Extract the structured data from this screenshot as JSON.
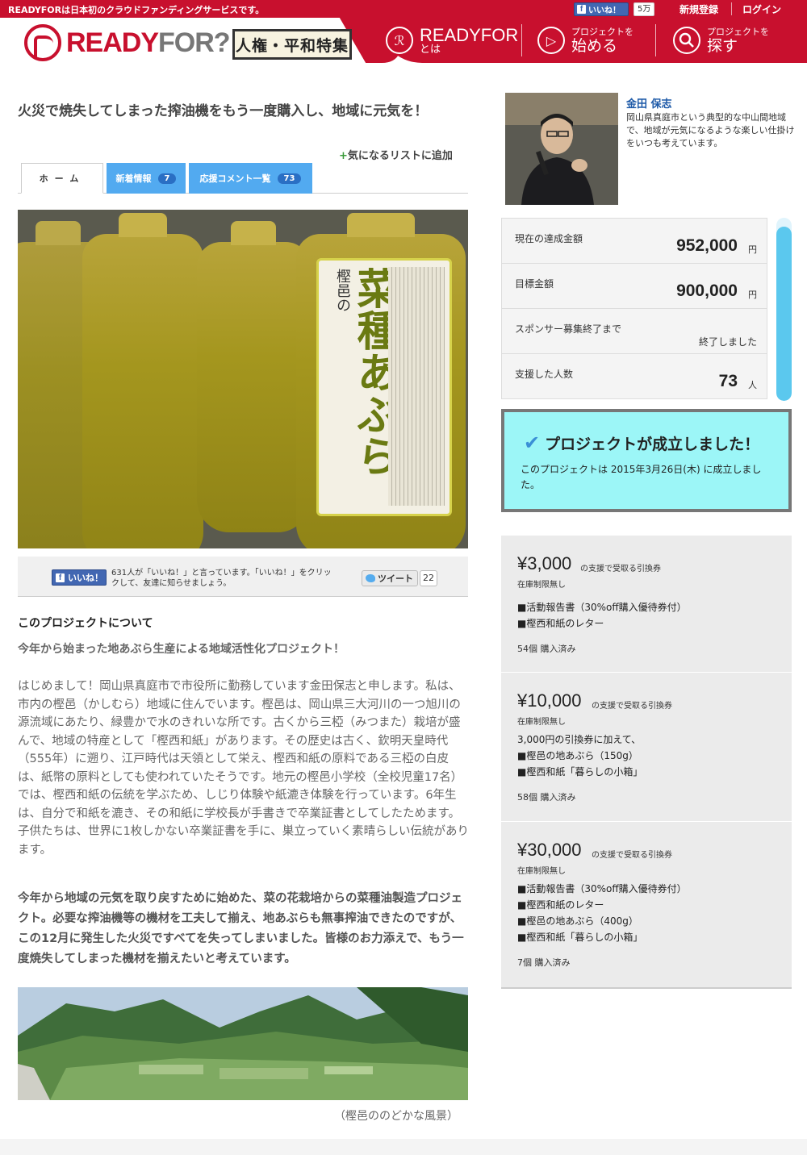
{
  "header": {
    "tagline": "READYFORは日本初のクラウドファンディングサービスです。",
    "fb_like_label": "いいね！",
    "fb_like_count": "5万",
    "signup_label": "新規登録",
    "login_label": "ログイン",
    "logo_ready": "READY",
    "logo_for": "FOR?",
    "campaign_badge": "人権・平和特集",
    "nav_about_big": "READYFOR",
    "nav_about_small": "とは",
    "nav_start_small": "プロジェクトを",
    "nav_start_big": "始める",
    "nav_search_small": "プロジェクトを",
    "nav_search_big": "探す"
  },
  "project": {
    "title": "火災で焼失してしまった搾油機をもう一度購入し、地域に元気を！",
    "watch_label": "気になるリストに追加",
    "tabs": [
      {
        "label": "ホーム"
      },
      {
        "label": "新着情報",
        "count": "7"
      },
      {
        "label": "応援コメント一覧",
        "count": "73"
      }
    ],
    "bottle_label_small": "樫邑の",
    "bottle_label_big": "菜種あぶら",
    "share": {
      "fb_like_label": "いいね！",
      "fb_like_text": "631人が「いいね！」と言っています。「いいね！」をクリックして、友達に知らせましょう。",
      "tweet_label": "ツイート",
      "tweet_count": "22"
    },
    "about_heading": "このプロジェクトについて",
    "about_subheading": "今年から始まった地あぶら生産による地域活性化プロジェクト！",
    "paragraph_1": "はじめまして！岡山県真庭市で市役所に勤務しています金田保志と申します。私は、市内の樫邑（かしむら）地域に住んでいます。樫邑は、岡山県三大河川の一つ旭川の源流域にあたり、緑豊かで水のきれいな所です。古くから三椏（みつまた）栽培が盛んで、地域の特産として「樫西和紙」があります。その歴史は古く、欽明天皇時代（555年）に遡り、江戸時代は天領として栄え、樫西和紙の原料である三椏の白皮は、紙幣の原料としても使われていたそうです。地元の樫邑小学校（全校児童17名）では、樫西和紙の伝統を学ぶため、しじり体験や紙漉き体験を行っています。6年生は、自分で和紙を漉き、その和紙に学校長が手書きで卒業証書としてしたためます。子供たちは、世界に1枚しかない卒業証書を手に、巣立っていく素晴らしい伝統があります。",
    "paragraph_2": "今年から地域の元気を取り戻すために始めた、菜の花栽培からの菜種油製造プロジェクト。必要な搾油機等の機材を工夫して揃え、地あぶらも無事搾油できたのですが、この12月に発生した火災ですべてを失ってしまいました。皆様のお力添えで、もう一度焼失してしまった機材を揃えたいと考えています。",
    "caption": "（樫邑ののどかな風景）"
  },
  "owner": {
    "name": "金田 保志",
    "bio": "岡山県真庭市という典型的な中山間地域で、地域が元気になるような楽しい仕掛けをいつも考えています。"
  },
  "stats": {
    "current_label": "現在の達成金額",
    "current_value": "952,000",
    "goal_label": "目標金額",
    "goal_value": "900,000",
    "yen_unit": "円",
    "deadline_label": "スポンサー募集終了まで",
    "deadline_value": "終了しました",
    "backers_label": "支援した人数",
    "backers_value": "73",
    "backers_unit": "人",
    "progress_fraction": 0.95
  },
  "success": {
    "title": "プロジェクトが成立しました！",
    "text": "このプロジェクトは 2015年3月26日(木) に成立しました。"
  },
  "rewards": [
    {
      "price": "¥3,000",
      "suffix": "の支援で受取る引換券",
      "limit": "在庫制限無し",
      "items": [
        "■活動報告書（30%off購入優待券付）",
        "■樫西和紙のレター"
      ],
      "sold": "54個 購入済み"
    },
    {
      "price": "¥10,000",
      "suffix": "の支援で受取る引換券",
      "limit": "在庫制限無し",
      "items": [
        "3,000円の引換券に加えて、",
        "■樫邑の地あぶら（150g）",
        "■樫西和紙「暮らしの小箱」"
      ],
      "sold": "58個 購入済み"
    },
    {
      "price": "¥30,000",
      "suffix": "の支援で受取る引換券",
      "limit": "在庫制限無し",
      "items": [
        "■活動報告書（30%off購入優待券付）",
        "■樫西和紙のレター",
        "■樫邑の地あぶら（400g）",
        "■樫西和紙「暮らしの小箱」"
      ],
      "sold": "7個 購入済み"
    }
  ],
  "colors": {
    "brand_red": "#c8102e",
    "tab_blue": "#52aaf0",
    "progress_blue": "#5bc8ee",
    "success_bg": "#9cf6f7"
  }
}
